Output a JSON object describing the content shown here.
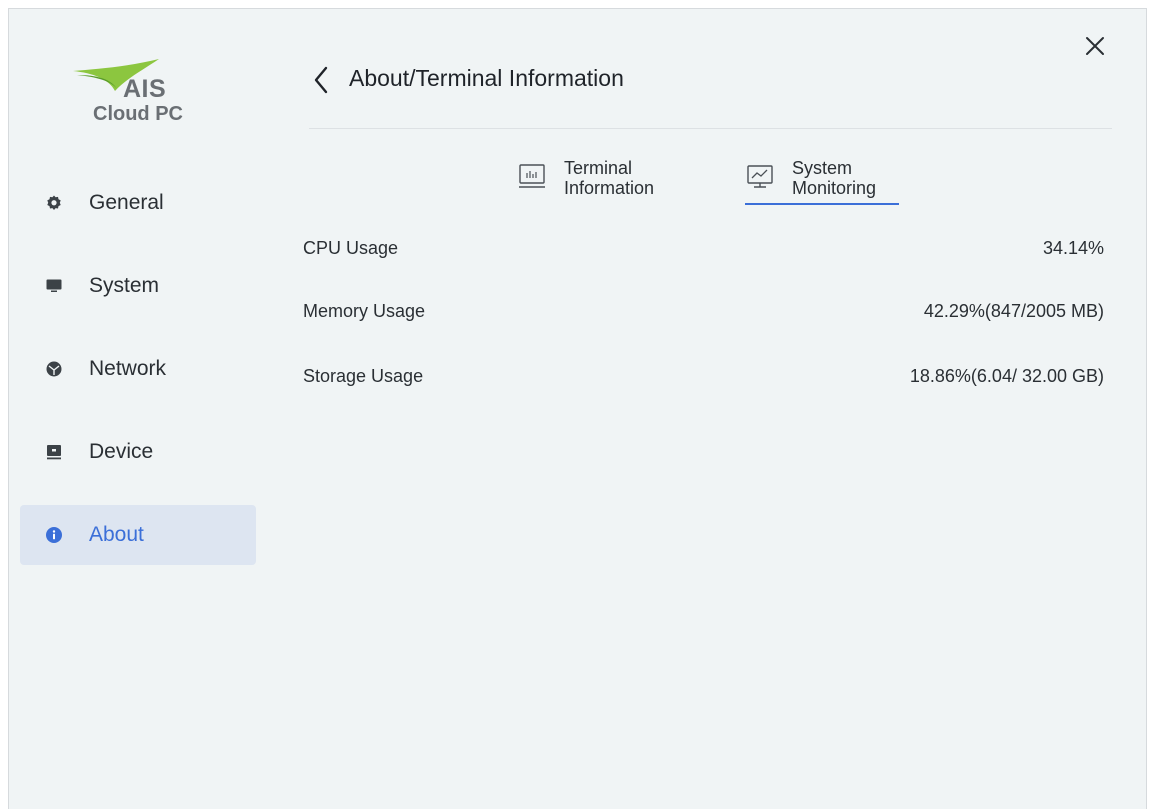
{
  "app": {
    "logo_brand": "AIS",
    "logo_product": "Cloud PC"
  },
  "header": {
    "title": "About/Terminal Information"
  },
  "sidebar": {
    "items": [
      {
        "label": "General",
        "icon": "gear-icon"
      },
      {
        "label": "System",
        "icon": "monitor-icon"
      },
      {
        "label": "Network",
        "icon": "network-icon"
      },
      {
        "label": "Device",
        "icon": "device-icon"
      },
      {
        "label": "About",
        "icon": "info-icon",
        "active": true
      }
    ]
  },
  "tabs": [
    {
      "line1": "Terminal",
      "line2": "Information",
      "icon": "chart-icon",
      "active": false
    },
    {
      "line1": "System",
      "line2": "Monitoring",
      "icon": "monitor-chart-icon",
      "active": true
    }
  ],
  "metrics": [
    {
      "label": "CPU Usage",
      "value": "34.14%"
    },
    {
      "label": "Memory Usage",
      "value": "42.29%(847/2005 MB)"
    },
    {
      "label": "Storage Usage",
      "value": "18.86%(6.04/ 32.00 GB)"
    }
  ],
  "colors": {
    "accent": "#3b6fd8",
    "active_nav_bg": "#dde5f1",
    "window_bg": "#f0f4f5",
    "logo_green": "#8cc63f"
  }
}
